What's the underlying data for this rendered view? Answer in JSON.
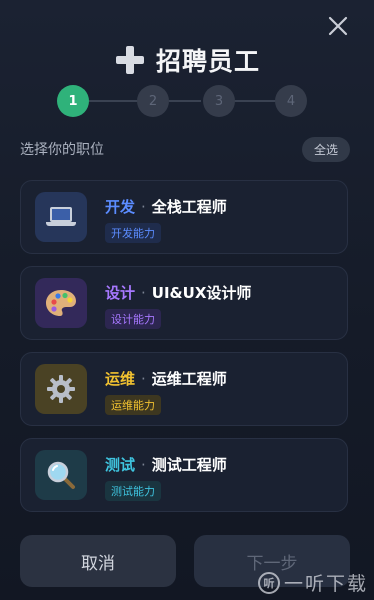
{
  "modal": {
    "title": "招聘员工",
    "title_icon": "plus-icon",
    "close_icon": "close-icon"
  },
  "stepper": {
    "steps": [
      "1",
      "2",
      "3",
      "4"
    ],
    "current_step": 1
  },
  "section": {
    "label": "选择你的职位",
    "select_all": "全选"
  },
  "positions": [
    {
      "dept": "开发",
      "separator": "·",
      "role": "全栈工程师",
      "tag": "开发能力",
      "icon": "laptop-icon",
      "color": "#5b8cff"
    },
    {
      "dept": "设计",
      "separator": "·",
      "role": "UI&UX设计师",
      "tag": "设计能力",
      "icon": "palette-icon",
      "color": "#a778ff"
    },
    {
      "dept": "运维",
      "separator": "·",
      "role": "运维工程师",
      "tag": "运维能力",
      "icon": "gear-icon",
      "color": "#f2c230"
    },
    {
      "dept": "测试",
      "separator": "·",
      "role": "测试工程师",
      "tag": "测试能力",
      "icon": "magnifier-icon",
      "color": "#3fc4df"
    }
  ],
  "footer": {
    "cancel": "取消",
    "next": "下一步"
  },
  "watermark": {
    "logo": "听",
    "text": "一听下载"
  }
}
